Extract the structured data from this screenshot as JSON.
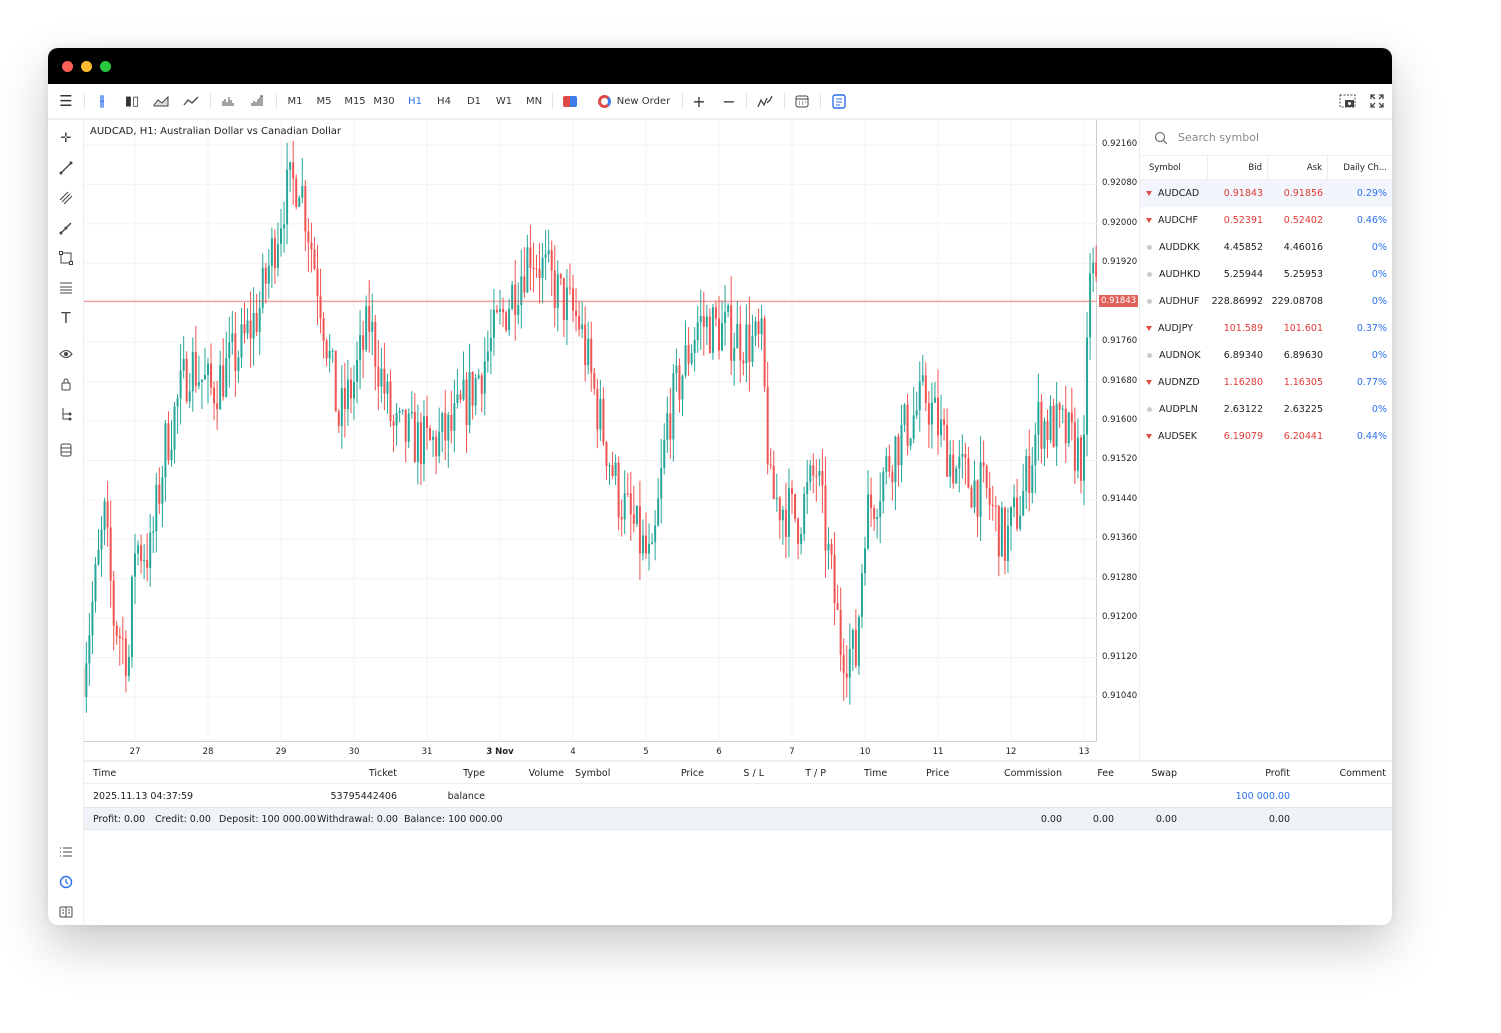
{
  "toolbar": {
    "timeframes": [
      "M1",
      "M5",
      "M15",
      "M30",
      "H1",
      "H4",
      "D1",
      "W1",
      "MN"
    ],
    "active_timeframe": "H1",
    "new_order": "New Order",
    "accent": "#2a6ff0"
  },
  "chart": {
    "title": "AUDCAD, H1: Australian Dollar vs Canadian Dollar",
    "current_price": "0.91843"
  },
  "chart_data": {
    "type": "candlestick",
    "symbol": "AUDCAD",
    "timeframe": "H1",
    "y_ticks": [
      "0.92160",
      "0.92080",
      "0.92000",
      "0.91920",
      "0.91840",
      "0.91760",
      "0.91680",
      "0.91600",
      "0.91520",
      "0.91440",
      "0.91360",
      "0.91280",
      "0.91200",
      "0.91120",
      "0.91040"
    ],
    "y_tick_labels": [
      "0.92160",
      "0.92080",
      "0.92000",
      "0.91920",
      "",
      "0.91760",
      "0.91680",
      "0.91600",
      "0.91520",
      "0.91440",
      "0.91360",
      "0.91280",
      "0.91200",
      "0.91120",
      "0.91040"
    ],
    "x_tick_labels": [
      "27",
      "28",
      "29",
      "30",
      "31",
      "3 Nov",
      "4",
      "5",
      "6",
      "7",
      "10",
      "11",
      "12",
      "13"
    ],
    "ylim": [
      0.9098,
      0.9222
    ],
    "current_price": 0.91843,
    "up_color": "#26a69a",
    "down_color": "#ef5350",
    "price_line_color": "#e0605a",
    "approx_close_path": [
      [
        "2025-10-24 07:00",
        0.911
      ],
      [
        "2025-10-24 14:00",
        0.914
      ],
      [
        "2025-10-24 17:00",
        0.912
      ],
      [
        "2025-10-24 22:00",
        0.9112
      ],
      [
        "2025-10-27 00:00",
        0.9135
      ],
      [
        "2025-10-27 05:00",
        0.9133
      ],
      [
        "2025-10-27 10:00",
        0.9155
      ],
      [
        "2025-10-27 18:00",
        0.9172
      ],
      [
        "2025-10-28 01:00",
        0.9166
      ],
      [
        "2025-10-28 11:00",
        0.9175
      ],
      [
        "2025-10-28 17:00",
        0.9183
      ],
      [
        "2025-10-29 01:00",
        0.9205
      ],
      [
        "2025-10-29 06:00",
        0.921
      ],
      [
        "2025-10-29 13:00",
        0.9185
      ],
      [
        "2025-10-29 19:00",
        0.916
      ],
      [
        "2025-10-30 00:00",
        0.9168
      ],
      [
        "2025-10-30 05:00",
        0.918
      ],
      [
        "2025-10-30 13:00",
        0.9158
      ],
      [
        "2025-10-31 01:00",
        0.9155
      ],
      [
        "2025-10-31 08:00",
        0.9158
      ],
      [
        "2025-10-31 16:00",
        0.9168
      ],
      [
        "2025-11-03 00:00",
        0.918
      ],
      [
        "2025-11-03 10:00",
        0.9195
      ],
      [
        "2025-11-03 20:00",
        0.9185
      ],
      [
        "2025-11-04 02:00",
        0.918
      ],
      [
        "2025-11-04 09:00",
        0.916
      ],
      [
        "2025-11-04 15:00",
        0.9145
      ],
      [
        "2025-11-05 02:00",
        0.913
      ],
      [
        "2025-11-05 07:00",
        0.916
      ],
      [
        "2025-11-05 17:00",
        0.918
      ],
      [
        "2025-11-06 03:00",
        0.9178
      ],
      [
        "2025-11-06 14:00",
        0.9175
      ],
      [
        "2025-11-06 17:00",
        0.9145
      ],
      [
        "2025-11-07 02:00",
        0.914
      ],
      [
        "2025-11-07 08:00",
        0.915
      ],
      [
        "2025-11-07 16:00",
        0.9115
      ],
      [
        "2025-11-07 21:00",
        0.9112
      ],
      [
        "2025-11-10 00:00",
        0.914
      ],
      [
        "2025-11-10 10:00",
        0.9155
      ],
      [
        "2025-11-10 20:00",
        0.9165
      ],
      [
        "2025-11-11 06:00",
        0.915
      ],
      [
        "2025-11-11 16:00",
        0.9145
      ],
      [
        "2025-11-11 22:00",
        0.9135
      ],
      [
        "2025-11-12 04:00",
        0.9145
      ],
      [
        "2025-11-12 09:00",
        0.916
      ],
      [
        "2025-11-12 17:00",
        0.9158
      ],
      [
        "2025-11-13 00:00",
        0.9152
      ],
      [
        "2025-11-13 02:00",
        0.9192
      ],
      [
        "2025-11-13 05:00",
        0.91843
      ]
    ]
  },
  "watchlist": {
    "search_placeholder": "Search symbol",
    "columns": [
      "Symbol",
      "Bid",
      "Ask",
      "Daily Ch..."
    ],
    "rows": [
      {
        "symbol": "AUDCAD",
        "bid": "0.91843",
        "ask": "0.91856",
        "change": "0.29%",
        "dir": "down"
      },
      {
        "symbol": "AUDCHF",
        "bid": "0.52391",
        "ask": "0.52402",
        "change": "0.46%",
        "dir": "down"
      },
      {
        "symbol": "AUDDKK",
        "bid": "4.45852",
        "ask": "4.46016",
        "change": "0%",
        "dir": "none"
      },
      {
        "symbol": "AUDHKD",
        "bid": "5.25944",
        "ask": "5.25953",
        "change": "0%",
        "dir": "none"
      },
      {
        "symbol": "AUDHUF",
        "bid": "228.86992",
        "ask": "229.08708",
        "change": "0%",
        "dir": "none"
      },
      {
        "symbol": "AUDJPY",
        "bid": "101.589",
        "ask": "101.601",
        "change": "0.37%",
        "dir": "down"
      },
      {
        "symbol": "AUDNOK",
        "bid": "6.89340",
        "ask": "6.89630",
        "change": "0%",
        "dir": "none"
      },
      {
        "symbol": "AUDNZD",
        "bid": "1.16280",
        "ask": "1.16305",
        "change": "0.77%",
        "dir": "down"
      },
      {
        "symbol": "AUDPLN",
        "bid": "2.63122",
        "ask": "2.63225",
        "change": "0%",
        "dir": "none"
      },
      {
        "symbol": "AUDSEK",
        "bid": "6.19079",
        "ask": "6.20441",
        "change": "0.44%",
        "dir": "down"
      }
    ]
  },
  "history": {
    "columns": {
      "time": "Time",
      "ticket": "Ticket",
      "type": "Type",
      "volume": "Volume",
      "symbol": "Symbol",
      "price": "Price",
      "sl": "S / L",
      "tp": "T / P",
      "time2": "Time",
      "price2": "Price",
      "commission": "Commission",
      "fee": "Fee",
      "swap": "Swap",
      "profit": "Profit",
      "comment": "Comment"
    },
    "row": {
      "time": "2025.11.13 04:37:59",
      "ticket": "53795442406",
      "type": "balance",
      "profit": "100 000.00"
    },
    "footer": {
      "profit": "Profit: 0.00",
      "credit": "Credit: 0.00",
      "deposit": "Deposit: 100 000.00",
      "withdrawal": "Withdrawal: 0.00",
      "balance": "Balance: 100 000.00",
      "commission": "0.00",
      "fee": "0.00",
      "swap": "0.00",
      "total_profit": "0.00"
    }
  }
}
